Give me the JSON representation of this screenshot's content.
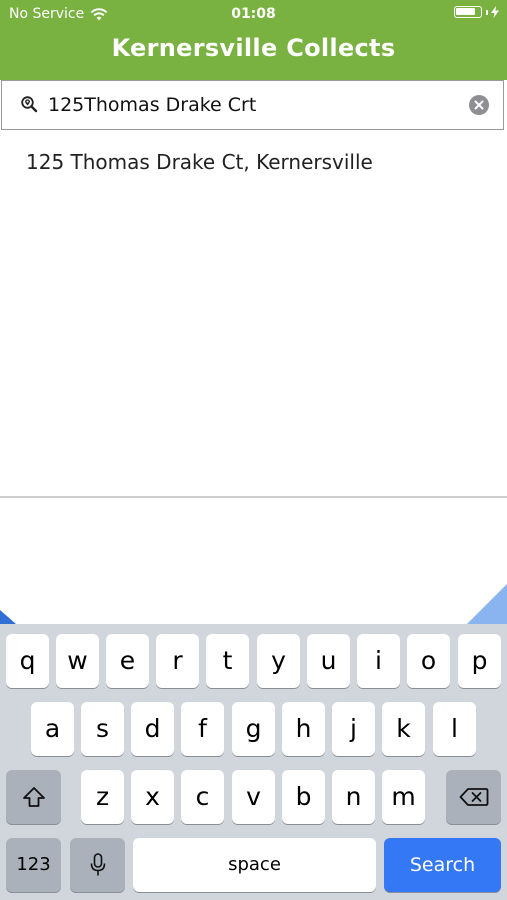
{
  "status_bar": {
    "carrier": "No Service",
    "time": "01:08",
    "battery_level": 0.85
  },
  "header": {
    "title": "Kernersville Collects",
    "color": "#7ab241"
  },
  "search": {
    "value": "125Thomas Drake Crt"
  },
  "suggestions": [
    "125 Thomas Drake Ct, Kernersville"
  ],
  "keyboard": {
    "row1": [
      "q",
      "w",
      "e",
      "r",
      "t",
      "y",
      "u",
      "i",
      "o",
      "p"
    ],
    "row2": [
      "a",
      "s",
      "d",
      "f",
      "g",
      "h",
      "j",
      "k",
      "l"
    ],
    "row3": [
      "z",
      "x",
      "c",
      "v",
      "b",
      "n",
      "m"
    ],
    "numbers_label": "123",
    "space_label": "space",
    "search_label": "Search",
    "accent_color": "#3478f6"
  }
}
